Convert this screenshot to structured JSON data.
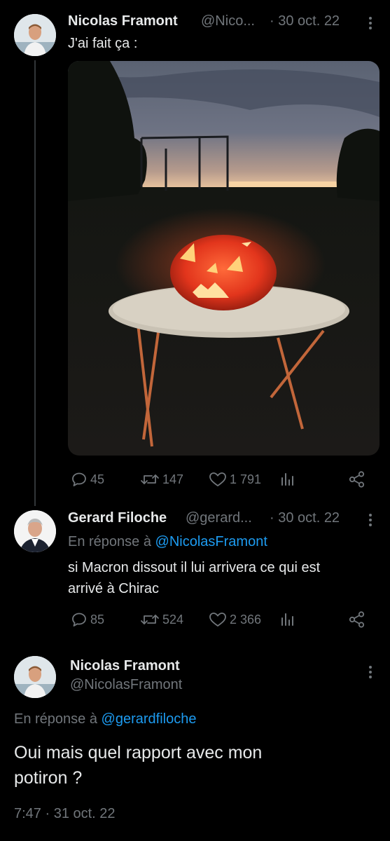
{
  "tweets": [
    {
      "author_name": "Nicolas Framont",
      "handle": "@Nico...",
      "date": "· 30 oct. 22",
      "text": "J'ai fait ça :",
      "replies": "45",
      "retweets": "147",
      "likes": "1 791",
      "image_description": "photo of a lit jack-o'-lantern pumpkin on a round garden table at dusk"
    },
    {
      "author_name": "Gerard Filoche",
      "handle": "@gerard...",
      "date": "· 30 oct. 22",
      "reply_prefix": "En réponse à ",
      "reply_to": "@NicolasFramont",
      "text_line1": "si Macron dissout il lui arrivera ce qui est",
      "text_line2": "arrivé à Chirac",
      "replies": "85",
      "retweets": "524",
      "likes": "2 366"
    }
  ],
  "main_tweet": {
    "author_name": "Nicolas Framont",
    "handle": "@NicolasFramont",
    "reply_prefix": "En réponse à ",
    "reply_to": "@gerardfiloche",
    "text_line1": "Oui mais quel rapport avec mon",
    "text_line2": "potiron ?",
    "timestamp": "7:47 · 31 oct. 22"
  },
  "icons": [
    "reply-icon",
    "retweet-icon",
    "like-icon",
    "views-icon",
    "share-icon",
    "more-icon"
  ],
  "colors": {
    "background": "#000000",
    "text": "#e7e9ea",
    "muted": "#71767b",
    "link": "#1d9bf0"
  }
}
